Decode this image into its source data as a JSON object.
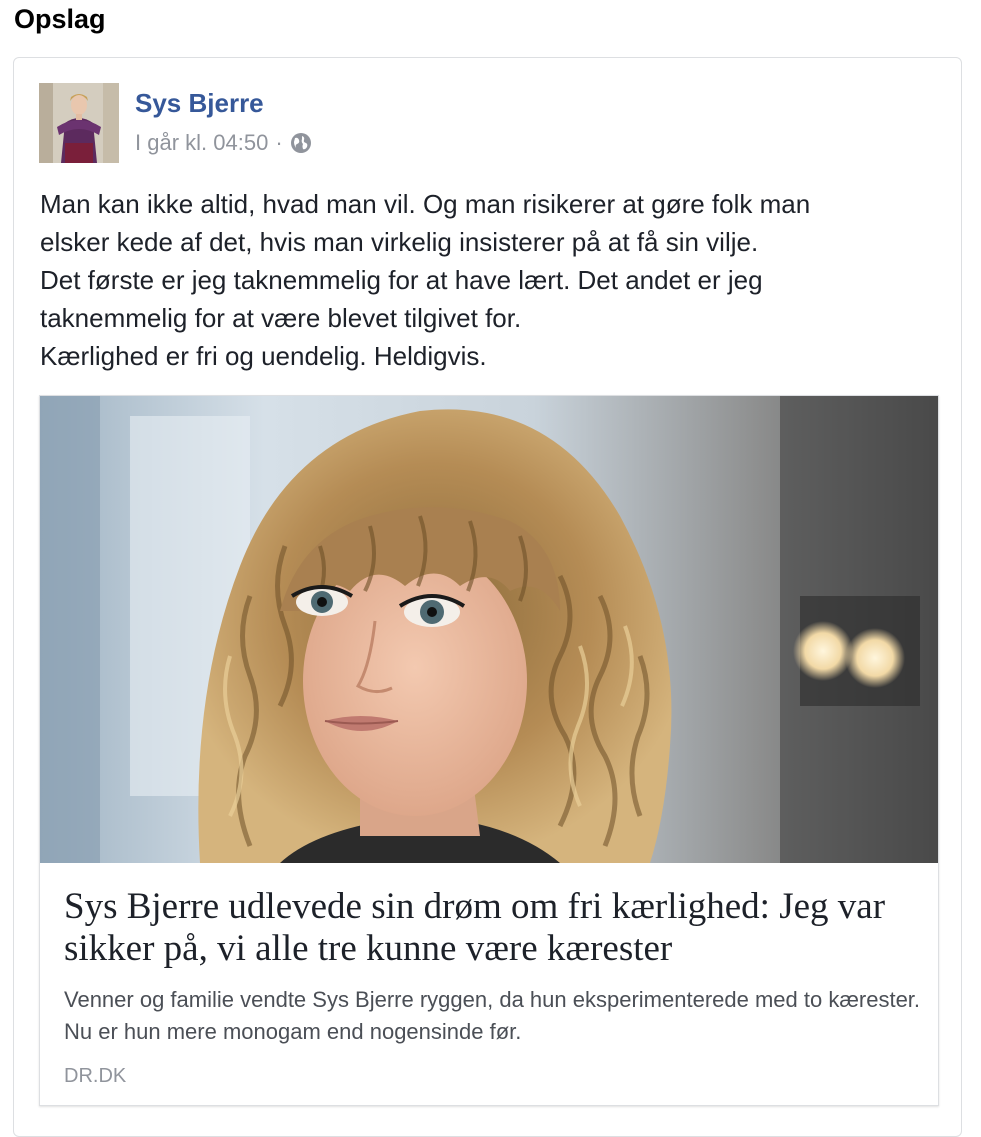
{
  "section": {
    "title": "Opslag"
  },
  "post": {
    "author": "Sys Bjerre",
    "timestamp": "I går kl. 04:50",
    "separator": "·",
    "privacy_icon": "globe-icon",
    "text_lines": [
      "Man kan ikke altid, hvad man vil. Og man risikerer at gøre folk man",
      "elsker kede af det, hvis man virkelig insisterer på at få sin vilje.",
      "Det første er jeg taknemmelig for at have lært. Det andet er jeg",
      "taknemmelig for at være blevet tilgivet for.",
      "Kærlighed er fri og uendelig. Heldigvis."
    ]
  },
  "link": {
    "title": "Sys Bjerre udlevede sin drøm om fri kærlighed: Jeg var sikker på, vi alle tre kunne være kærester",
    "description": "Venner og familie vendte Sys Bjerre ryggen, da hun eksperimenterede med to kærester. Nu er hun mere monogam end nogensinde før.",
    "domain": "DR.DK"
  },
  "colors": {
    "author_link": "#365899",
    "secondary_text": "#90949c",
    "border": "#dddfe2"
  }
}
